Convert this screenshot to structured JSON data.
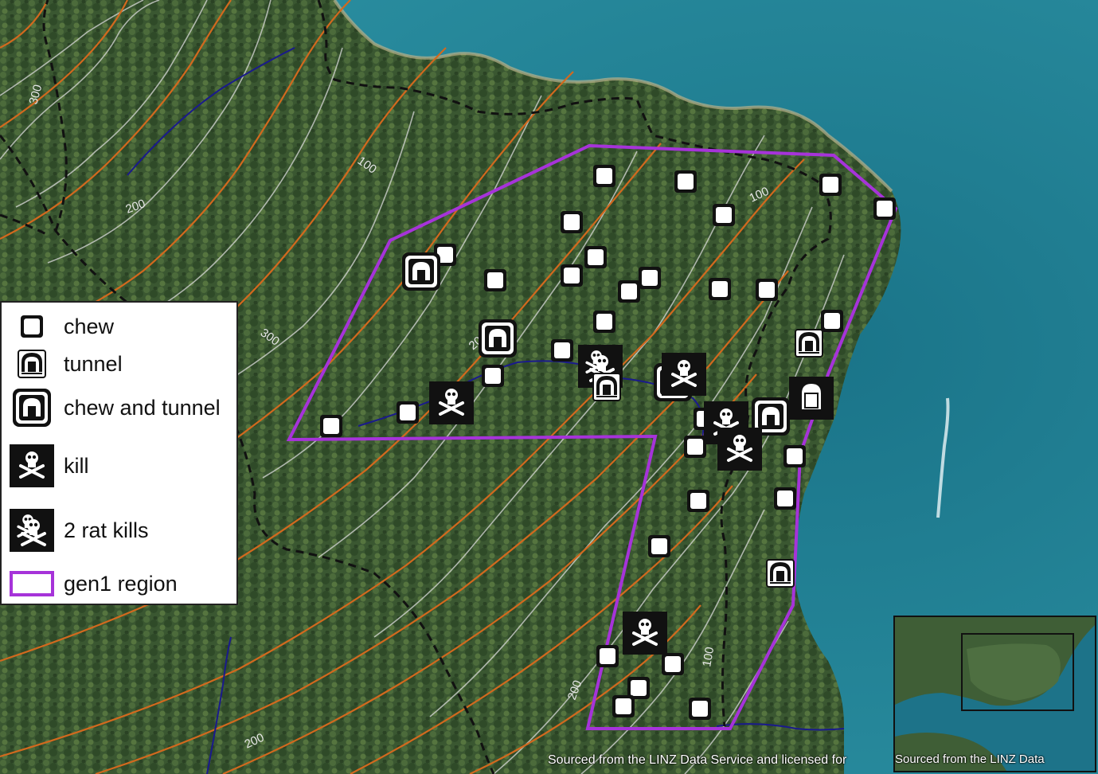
{
  "legend": {
    "chew": "chew",
    "tunnel": "tunnel",
    "chew_and_tunnel": "chew and tunnel",
    "kill": "kill",
    "two_rat_kills": "2 rat kills",
    "gen1_region": "gen1 region"
  },
  "contour_labels": [
    "300",
    "100",
    "200",
    "300",
    "100",
    "200",
    "100",
    "200",
    "200"
  ],
  "attribution": {
    "main": "Sourced from the LINZ Data Service and licensed for",
    "inset": "Sourced from the LINZ Data"
  },
  "colors": {
    "gen1_region": "#a633d9",
    "contour_major": "#d2691e",
    "contour_minor": "#d9d9d9",
    "track": "#111111",
    "stream": "#1a1a8c",
    "sea": "#1f7d93",
    "forest": "#3d5c33"
  },
  "icon_names": [
    "chew-icon",
    "tunnel-icon",
    "chew-and-tunnel-icon",
    "kill-icon",
    "two-rat-kills-icon"
  ]
}
